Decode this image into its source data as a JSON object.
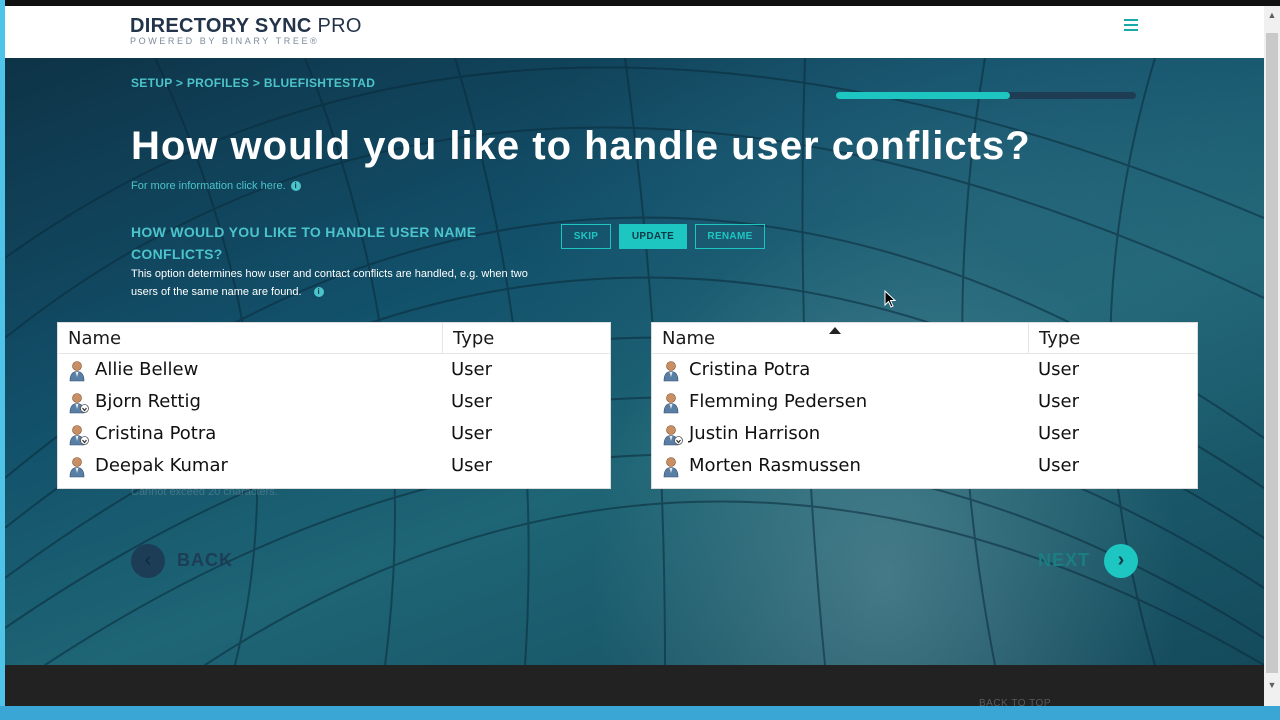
{
  "header": {
    "logo_title_bold": "DIRECTORY SYNC",
    "logo_title_thin": " PRO",
    "logo_subtitle": "POWERED BY BINARY TREE®",
    "menu_icon": "hamburger-menu-icon"
  },
  "main": {
    "breadcrumb": "SETUP > PROFILES > BLUEFISHTESTAD",
    "progress_fraction": 0.58,
    "title": "How would you like to handle user conflicts?",
    "more_info": "For more information click here.",
    "option_heading": "HOW WOULD YOU LIKE TO HANDLE USER NAME CONFLICTS?",
    "option_description": "This option determines how user and contact conflicts are handled, e.g. when two users of the same name are found.",
    "options": {
      "skip": "SKIP",
      "update": "UPDATE",
      "rename": "RENAME",
      "selected": "UPDATE"
    },
    "faded_note": "Cannot exceed 20 characters.",
    "back_label": "BACK",
    "next_label": "NEXT"
  },
  "lists": {
    "left": {
      "columns": [
        "Name",
        "Type"
      ],
      "rows": [
        {
          "name": "Allie Bellew",
          "type": "User",
          "icon": "user-icon"
        },
        {
          "name": "Bjorn Rettig",
          "type": "User",
          "icon": "user-sync-icon"
        },
        {
          "name": "Cristina Potra",
          "type": "User",
          "icon": "user-sync-icon"
        },
        {
          "name": "Deepak Kumar",
          "type": "User",
          "icon": "user-icon"
        }
      ]
    },
    "right": {
      "columns": [
        "Name",
        "Type"
      ],
      "sorted_column": "Name",
      "rows": [
        {
          "name": "Cristina Potra",
          "type": "User",
          "icon": "user-icon"
        },
        {
          "name": "Flemming Pedersen",
          "type": "User",
          "icon": "user-icon"
        },
        {
          "name": "Justin Harrison",
          "type": "User",
          "icon": "user-sync-icon"
        },
        {
          "name": "Morten Rasmussen",
          "type": "User",
          "icon": "user-icon"
        }
      ]
    }
  },
  "footer": {
    "back_to_top": "BACK TO TOP"
  },
  "colors": {
    "accent": "#1ec6c1",
    "header_text": "#23344a",
    "footer_bg": "#222222"
  }
}
